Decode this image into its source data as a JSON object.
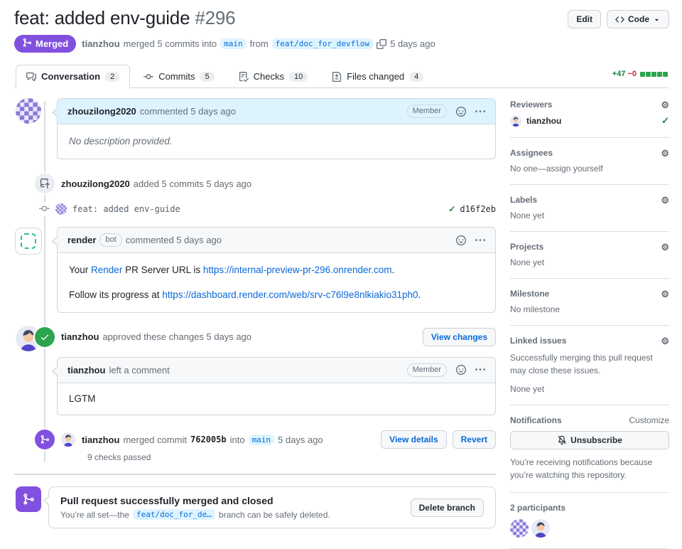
{
  "header": {
    "title": "feat: added env-guide",
    "number": "#296",
    "edit_label": "Edit",
    "code_label": "Code",
    "state_label": "Merged",
    "author": "tianzhou",
    "action": "merged 5 commits into",
    "base_branch": "main",
    "from_word": "from",
    "head_branch": "feat/doc_for_devflow",
    "time": "5 days ago"
  },
  "tabs": {
    "items": [
      {
        "label": "Conversation",
        "count": "2"
      },
      {
        "label": "Commits",
        "count": "5"
      },
      {
        "label": "Checks",
        "count": "10"
      },
      {
        "label": "Files changed",
        "count": "4"
      }
    ]
  },
  "diffstat": {
    "additions": "+47",
    "deletions": "−0"
  },
  "timeline": {
    "comment1": {
      "author": "zhouzilong2020",
      "meta": "commented 5 days ago",
      "badge": "Member",
      "body": "No description provided."
    },
    "push_event": {
      "author": "zhouzilong2020",
      "meta": "added 5 commits 5 days ago"
    },
    "commit": {
      "message": "feat: added env-guide",
      "check": "✓",
      "sha": "d16f2eb"
    },
    "bot_comment": {
      "author": "render",
      "badge": "bot",
      "meta": "commented 5 days ago",
      "p1_pre": "Your ",
      "p1_link1": "Render",
      "p1_mid": " PR Server URL is ",
      "p1_link2": "https://internal-preview-pr-296.onrender.com",
      "p1_end": ".",
      "p2_pre": "Follow its progress at ",
      "p2_link": "https://dashboard.render.com/web/srv-c76l9e8nlkiakio31ph0",
      "p2_end": "."
    },
    "approval": {
      "author": "tianzhou",
      "meta": "approved these changes 5 days ago",
      "button": "View changes"
    },
    "review_comment": {
      "author": "tianzhou",
      "meta": "left a comment",
      "badge": "Member",
      "body": "LGTM"
    },
    "merge_event": {
      "author": "tianzhou",
      "action": "merged commit",
      "sha": "762005b",
      "into_word": "into",
      "branch": "main",
      "time": "5 days ago",
      "checks": "9 checks passed",
      "details_button": "View details",
      "revert_button": "Revert"
    },
    "merged_box": {
      "title": "Pull request successfully merged and closed",
      "body_pre": "You’re all set—the",
      "branch": "feat/doc_for_de…",
      "body_post": "branch can be safely deleted.",
      "delete_button": "Delete branch"
    }
  },
  "sidebar": {
    "reviewers": {
      "title": "Reviewers",
      "name": "tianzhou",
      "check": "✓"
    },
    "assignees": {
      "title": "Assignees",
      "empty": "No one—assign yourself"
    },
    "labels": {
      "title": "Labels",
      "empty": "None yet"
    },
    "projects": {
      "title": "Projects",
      "empty": "None yet"
    },
    "milestone": {
      "title": "Milestone",
      "empty": "No milestone"
    },
    "linked_issues": {
      "title": "Linked issues",
      "caption": "Successfully merging this pull request may close these issues.",
      "empty": "None yet"
    },
    "notifications": {
      "title": "Notifications",
      "customize": "Customize",
      "button": "Unsubscribe",
      "caption": "You’re receiving notifications because you’re watching this repository."
    },
    "participants": {
      "title": "2 participants"
    }
  },
  "colors": {
    "merged_purple": "#8250df",
    "link_blue": "#0969da",
    "success_green": "#2da44e",
    "deletion_red": "#cf222e",
    "branch_chip_bg": "#ddf4ff",
    "border": "#d0d7de"
  }
}
